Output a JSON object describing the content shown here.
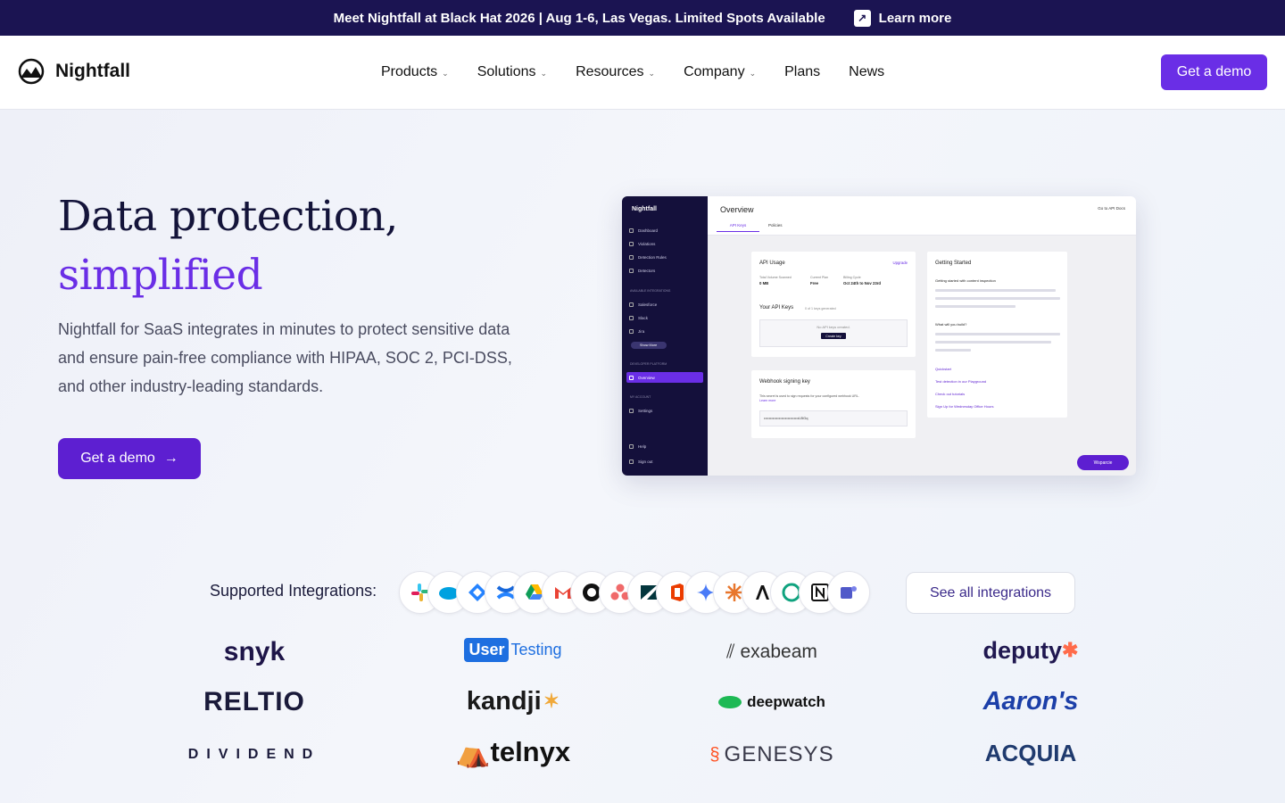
{
  "banner": {
    "text": "Meet Nightfall at Black Hat 2026 | Aug 1-6, Las Vegas. Limited Spots Available",
    "link": "Learn more"
  },
  "nav": {
    "brand": "Nightfall",
    "menu": [
      {
        "label": "Products",
        "dropdown": true
      },
      {
        "label": "Solutions",
        "dropdown": true
      },
      {
        "label": "Resources",
        "dropdown": true
      },
      {
        "label": "Company",
        "dropdown": true
      },
      {
        "label": "Plans",
        "dropdown": false
      },
      {
        "label": "News",
        "dropdown": false
      }
    ],
    "cta": "Get a demo"
  },
  "hero": {
    "title_line1": "Data protection,",
    "title_line2": "simplified",
    "description": "Nightfall for SaaS integrates in minutes to protect sensitive data and ensure pain-free compliance with HIPAA, SOC 2, PCI-DSS, and other industry-leading standards.",
    "cta": "Get a demo"
  },
  "product_shot": {
    "brand": "Nightfall",
    "sidebar": [
      "Dashboard",
      "Violations",
      "Detection Rules",
      "Detectors"
    ],
    "section_integrations": "Available Integrations",
    "integrations": [
      "Salesforce",
      "Slack",
      "Jira"
    ],
    "show_more": "Show More",
    "section_dev": "Developer Platform",
    "dev_item": "Overview",
    "section_account": "My Account",
    "account_item": "Settings",
    "footer_items": [
      "Help",
      "Sign out"
    ],
    "page_title": "Overview",
    "docs_link": "Go to API Docs",
    "tabs": [
      "API Keys",
      "Policies"
    ],
    "api_usage": {
      "title": "API Usage",
      "upgrade": "Upgrade",
      "cols": [
        "Total Volume Scanned",
        "Current Plan",
        "Billing Cycle"
      ],
      "vals": [
        "0 MB",
        "Free",
        "Oct 24th to Nov 23rd"
      ]
    },
    "api_keys": {
      "title": "Your API Keys",
      "sub": "0 of 1 keys generated",
      "empty": "No API keys created.",
      "create": "Create key"
    },
    "webhook": {
      "title": "Webhook signing key",
      "desc": "This secret is used to sign requests for your configured webhook URL.",
      "learn": "Learn more",
      "key": "••••••••••••••••••••••••••••LBGq"
    },
    "getting_started": {
      "title": "Getting Started",
      "subtitle": "Getting started with content inspection",
      "q": "What will you build?",
      "links": [
        "Quickstart",
        "Test detection in our Playground",
        "Check out tutorials",
        "Sign Up for Wednesday Office Hours"
      ]
    },
    "float_btn": "Wsparcie"
  },
  "integrations": {
    "label": "Supported Integrations:",
    "icons": [
      "slack-icon",
      "salesforce-icon",
      "jira-icon",
      "confluence-icon",
      "google-drive-icon",
      "gmail-icon",
      "github-icon",
      "asana-icon",
      "zendesk-icon",
      "office-icon",
      "gemini-icon",
      "perplexity-icon",
      "anthropic-icon",
      "openai-icon",
      "notion-icon",
      "teams-icon"
    ],
    "see_all": "See all integrations"
  },
  "customers": {
    "snyk": "snyk",
    "usertesting_a": "User",
    "usertesting_b": "Testing",
    "exabeam": "exabeam",
    "deputy": "deputy",
    "reltio": "RELTIO",
    "kandji": "kandji",
    "deepwatch": "deepwatch",
    "aarons": "Aaron's",
    "dividend": "DIVIDEND",
    "telnyx": "telnyx",
    "genesys": "GENESYS",
    "acquia": "ACQUIA"
  },
  "colors": {
    "brand_purple": "#6a2ee6",
    "banner_bg": "#1b1452",
    "sidebar_bg": "#14103b"
  }
}
